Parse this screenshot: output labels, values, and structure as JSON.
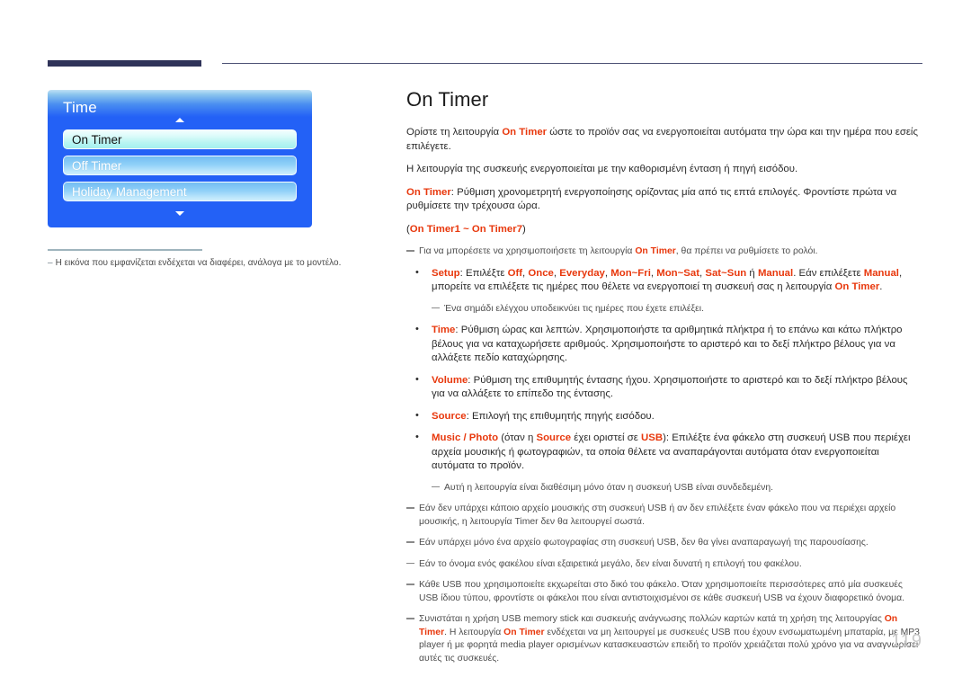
{
  "header": {
    "bar_color": "#2f3359",
    "line_color": "#4a4f73"
  },
  "accent_color": "#e8380d",
  "osd": {
    "title": "Time",
    "up_arrow": "scroll-up-arrow",
    "down_arrow": "scroll-down-arrow",
    "items": [
      {
        "label": "On Timer",
        "selected": true
      },
      {
        "label": "Off Timer",
        "selected": false
      },
      {
        "label": "Holiday Management",
        "selected": false
      }
    ]
  },
  "left_note": {
    "dash": "–",
    "text": "Η εικόνα που εμφανίζεται ενδέχεται να διαφέρει, ανάλογα με το μοντέλο."
  },
  "main": {
    "title": "On Timer",
    "paragraphs": [
      {
        "id": "p1",
        "parts": [
          {
            "t": "Ορίστε τη λειτουργία ",
            "s": "plain"
          },
          {
            "t": "On Timer",
            "s": "red"
          },
          {
            "t": " ώστε το προϊόν σας να ενεργοποιείται αυτόματα την ώρα και την ημέρα που εσείς επιλέγετε.",
            "s": "plain"
          }
        ]
      },
      {
        "id": "p2",
        "parts": [
          {
            "t": "Η λειτουργία της συσκευής ενεργοποιείται με την καθορισμένη ένταση ή πηγή εισόδου.",
            "s": "plain"
          }
        ]
      },
      {
        "id": "p3",
        "parts": [
          {
            "t": "On Timer",
            "s": "red"
          },
          {
            "t": ": Ρύθμιση χρονομετρητή ενεργοποίησης ορίζοντας μία από τις επτά επιλογές. Φροντίστε πρώτα να ρυθμίσετε την τρέχουσα ώρα.",
            "s": "plain"
          }
        ]
      },
      {
        "id": "p4",
        "parts": [
          {
            "t": "(",
            "s": "plain"
          },
          {
            "t": "On Timer1 ~ On Timer7",
            "s": "red"
          },
          {
            "t": ")",
            "s": "plain"
          }
        ]
      }
    ],
    "note_clock": {
      "parts": [
        {
          "t": "Για να μπορέσετε να χρησιμοποιήσετε τη λειτουργία ",
          "s": "plain"
        },
        {
          "t": "On Timer",
          "s": "red"
        },
        {
          "t": ", θα πρέπει να ρυθμίσετε το ρολόι.",
          "s": "plain"
        }
      ]
    },
    "bullets": [
      {
        "id": "setup",
        "parts": [
          {
            "t": "Setup",
            "s": "red"
          },
          {
            "t": ": Επιλέξτε ",
            "s": "plain"
          },
          {
            "t": "Off",
            "s": "red"
          },
          {
            "t": ", ",
            "s": "plain"
          },
          {
            "t": "Once",
            "s": "red"
          },
          {
            "t": ", ",
            "s": "plain"
          },
          {
            "t": "Everyday",
            "s": "red"
          },
          {
            "t": ", ",
            "s": "plain"
          },
          {
            "t": "Mon~Fri",
            "s": "red"
          },
          {
            "t": ", ",
            "s": "plain"
          },
          {
            "t": "Mon~Sat",
            "s": "red"
          },
          {
            "t": ", ",
            "s": "plain"
          },
          {
            "t": "Sat~Sun",
            "s": "red"
          },
          {
            "t": " ή ",
            "s": "plain"
          },
          {
            "t": "Manual",
            "s": "red"
          },
          {
            "t": ". Εάν επιλέξετε ",
            "s": "plain"
          },
          {
            "t": "Manual",
            "s": "red"
          },
          {
            "t": ", μπορείτε να επιλέξετε τις ημέρες που θέλετε να ενεργοποιεί τη συσκευή σας η λειτουργία ",
            "s": "plain"
          },
          {
            "t": "On Timer",
            "s": "red"
          },
          {
            "t": ".",
            "s": "plain"
          }
        ],
        "subnote": "Ένα σημάδι ελέγχου υποδεικνύει τις ημέρες που έχετε επιλέξει."
      },
      {
        "id": "time",
        "parts": [
          {
            "t": "Time",
            "s": "red"
          },
          {
            "t": ": Ρύθμιση ώρας και λεπτών. Χρησιμοποιήστε τα αριθμητικά πλήκτρα ή το επάνω και κάτω πλήκτρο βέλους για να καταχωρήσετε αριθμούς. Χρησιμοποιήστε το αριστερό και το δεξί πλήκτρο βέλους για να αλλάξετε πεδίο καταχώρησης.",
            "s": "plain"
          }
        ],
        "subnote": ""
      },
      {
        "id": "volume",
        "parts": [
          {
            "t": "Volume",
            "s": "red"
          },
          {
            "t": ": Ρύθμιση της επιθυμητής έντασης ήχου. Χρησιμοποιήστε το αριστερό και το δεξί πλήκτρο βέλους για να αλλάξετε το επίπεδο της έντασης.",
            "s": "plain"
          }
        ],
        "subnote": ""
      },
      {
        "id": "source",
        "parts": [
          {
            "t": "Source",
            "s": "red"
          },
          {
            "t": ": Επιλογή της επιθυμητής πηγής εισόδου.",
            "s": "plain"
          }
        ],
        "subnote": ""
      },
      {
        "id": "music-photo",
        "parts": [
          {
            "t": "Music / Photo",
            "s": "red"
          },
          {
            "t": " (όταν η ",
            "s": "plain"
          },
          {
            "t": "Source",
            "s": "red"
          },
          {
            "t": " έχει οριστεί σε ",
            "s": "plain"
          },
          {
            "t": "USB",
            "s": "red"
          },
          {
            "t": "): Επιλέξτε ένα φάκελο στη συσκευή USB που περιέχει αρχεία μουσικής ή φωτογραφιών, τα οποία θέλετε να αναπαράγονται αυτόματα όταν ενεργοποιείται αυτόματα το προϊόν.",
            "s": "plain"
          }
        ],
        "subnote": "Αυτή η λειτουργία είναι διαθέσιμη μόνο όταν η συσκευή USB είναι συνδεδεμένη."
      }
    ],
    "footer_notes": [
      {
        "id": "note-music-file",
        "parts": [
          {
            "t": "Εάν δεν υπάρχει κάποιο αρχείο μουσικής στη συσκευή USB ή αν δεν επιλέξετε έναν φάκελο που να περιέχει αρχείο μουσικής, η λειτουργία Timer δεν θα λειτουργεί σωστά.",
            "s": "plain"
          }
        ]
      },
      {
        "id": "note-single-photo",
        "parts": [
          {
            "t": "Εάν υπάρχει μόνο ένα αρχείο φωτογραφίας στη συσκευή USB, δεν θα γίνει αναπαραγωγή της παρουσίασης.",
            "s": "plain"
          }
        ]
      },
      {
        "id": "note-long-folder-name",
        "parts": [
          {
            "t": "Εάν το όνομα ενός φακέλου είναι εξαιρετικά μεγάλο, δεν είναι δυνατή η επιλογή του φακέλου.",
            "s": "plain"
          }
        ]
      },
      {
        "id": "note-usb-folder",
        "parts": [
          {
            "t": "Κάθε USB που χρησιμοποιείτε εκχωρείται στο δικό του φάκελο. Όταν χρησιμοποιείτε περισσότερες από μία συσκευές USB ίδιου τύπου, φροντίστε οι φάκελοι που είναι αντιστοιχισμένοι σε κάθε συσκευή USB να έχουν διαφορετικό όνομα.",
            "s": "plain"
          }
        ]
      },
      {
        "id": "note-memory-stick",
        "parts": [
          {
            "t": "Συνιστάται η χρήση USB memory stick και συσκευής ανάγνωσης πολλών καρτών κατά τη χρήση της λειτουργίας ",
            "s": "plain"
          },
          {
            "t": "On Timer",
            "s": "red"
          },
          {
            "t": ". Η λειτουργία ",
            "s": "plain"
          },
          {
            "t": "On Timer",
            "s": "red"
          },
          {
            "t": " ενδέχεται να μη λειτουργεί με συσκευές USB που έχουν ενσωματωμένη μπαταρία, με MP3 player ή με φορητά media player ορισμένων κατασκευαστών επειδή το προϊόν χρειάζεται πολύ χρόνο για να αναγνωρίσει αυτές τις συσκευές.",
            "s": "plain"
          }
        ]
      }
    ]
  },
  "page_number": "119"
}
